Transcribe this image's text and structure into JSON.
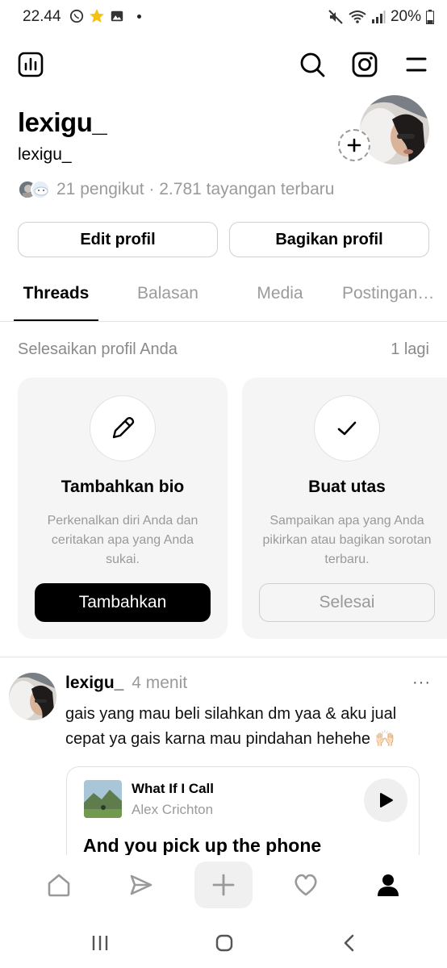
{
  "status_bar": {
    "time": "22.44",
    "battery": "20%"
  },
  "top_bar": {
    "icons": [
      "insights-icon",
      "search-icon",
      "instagram-icon",
      "menu-icon"
    ]
  },
  "profile": {
    "name": "lexigu_",
    "handle": "lexigu_",
    "followers_text": "21 pengikut · 2.781 tayangan terbaru",
    "edit_button": "Edit profil",
    "share_button": "Bagikan profil"
  },
  "tabs": [
    {
      "label": "Threads",
      "active": true
    },
    {
      "label": "Balasan",
      "active": false
    },
    {
      "label": "Media",
      "active": false
    },
    {
      "label": "Postingan…",
      "active": false
    }
  ],
  "complete_profile": {
    "title": "Selesaikan profil Anda",
    "remaining": "1 lagi",
    "cards": [
      {
        "icon": "pencil-icon",
        "title": "Tambahkan bio",
        "description": "Perkenalkan diri Anda dan ceritakan apa yang Anda sukai.",
        "button": "Tambahkan"
      },
      {
        "icon": "checkmark-icon",
        "title": "Buat utas",
        "description": "Sampaikan apa yang Anda pikirkan atau bagikan sorotan terbaru.",
        "button": "Selesai"
      }
    ]
  },
  "post": {
    "username": "lexigu_",
    "time": "4 menit",
    "more": "···",
    "text": "gais yang mau beli silahkan dm yaa & aku jual cepat ya gais karna mau pindahan hehehe 🙌🏻",
    "music": {
      "title": "What If I Call",
      "artist": "Alex Crichton",
      "lyric": "And you pick up the phone"
    }
  },
  "bottom_nav": {
    "items": [
      "home-icon",
      "send-icon",
      "plus-icon",
      "heart-icon",
      "profile-icon"
    ],
    "active": "profile-icon"
  },
  "colors": {
    "text": "#000000",
    "muted": "#9a9a9a",
    "card_bg": "#f5f5f5",
    "border": "#d0d0d0"
  }
}
